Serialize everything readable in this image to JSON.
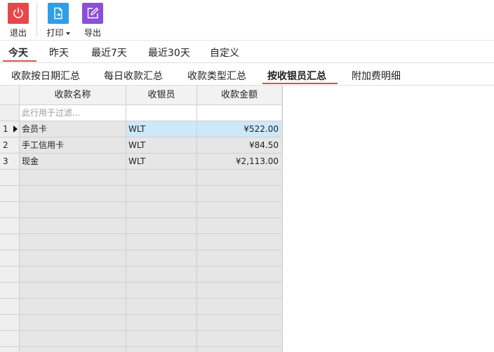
{
  "toolbar": {
    "exit_label": "退出",
    "print_label": "打印",
    "export_label": "导出",
    "colors": {
      "exit": "#e8474a",
      "print": "#2d9ee7",
      "export": "#8b4fd8"
    }
  },
  "date_tabs": [
    "今天",
    "昨天",
    "最近7天",
    "最近30天",
    "自定义"
  ],
  "view_tabs": [
    "收款按日期汇总",
    "每日收款汇总",
    "收款类型汇总",
    "按收银员汇总",
    "附加费明细"
  ],
  "grid": {
    "columns": [
      "收款名称",
      "收银员",
      "收款金额"
    ],
    "filter_placeholder": "此行用于过滤...",
    "rows": [
      {
        "index": "1",
        "name": "会员卡",
        "cashier": "WLT",
        "amount": "¥522.00"
      },
      {
        "index": "2",
        "name": "手工信用卡",
        "cashier": "WLT",
        "amount": "¥84.50"
      },
      {
        "index": "3",
        "name": "现金",
        "cashier": "WLT",
        "amount": "¥2,113.00"
      }
    ]
  }
}
